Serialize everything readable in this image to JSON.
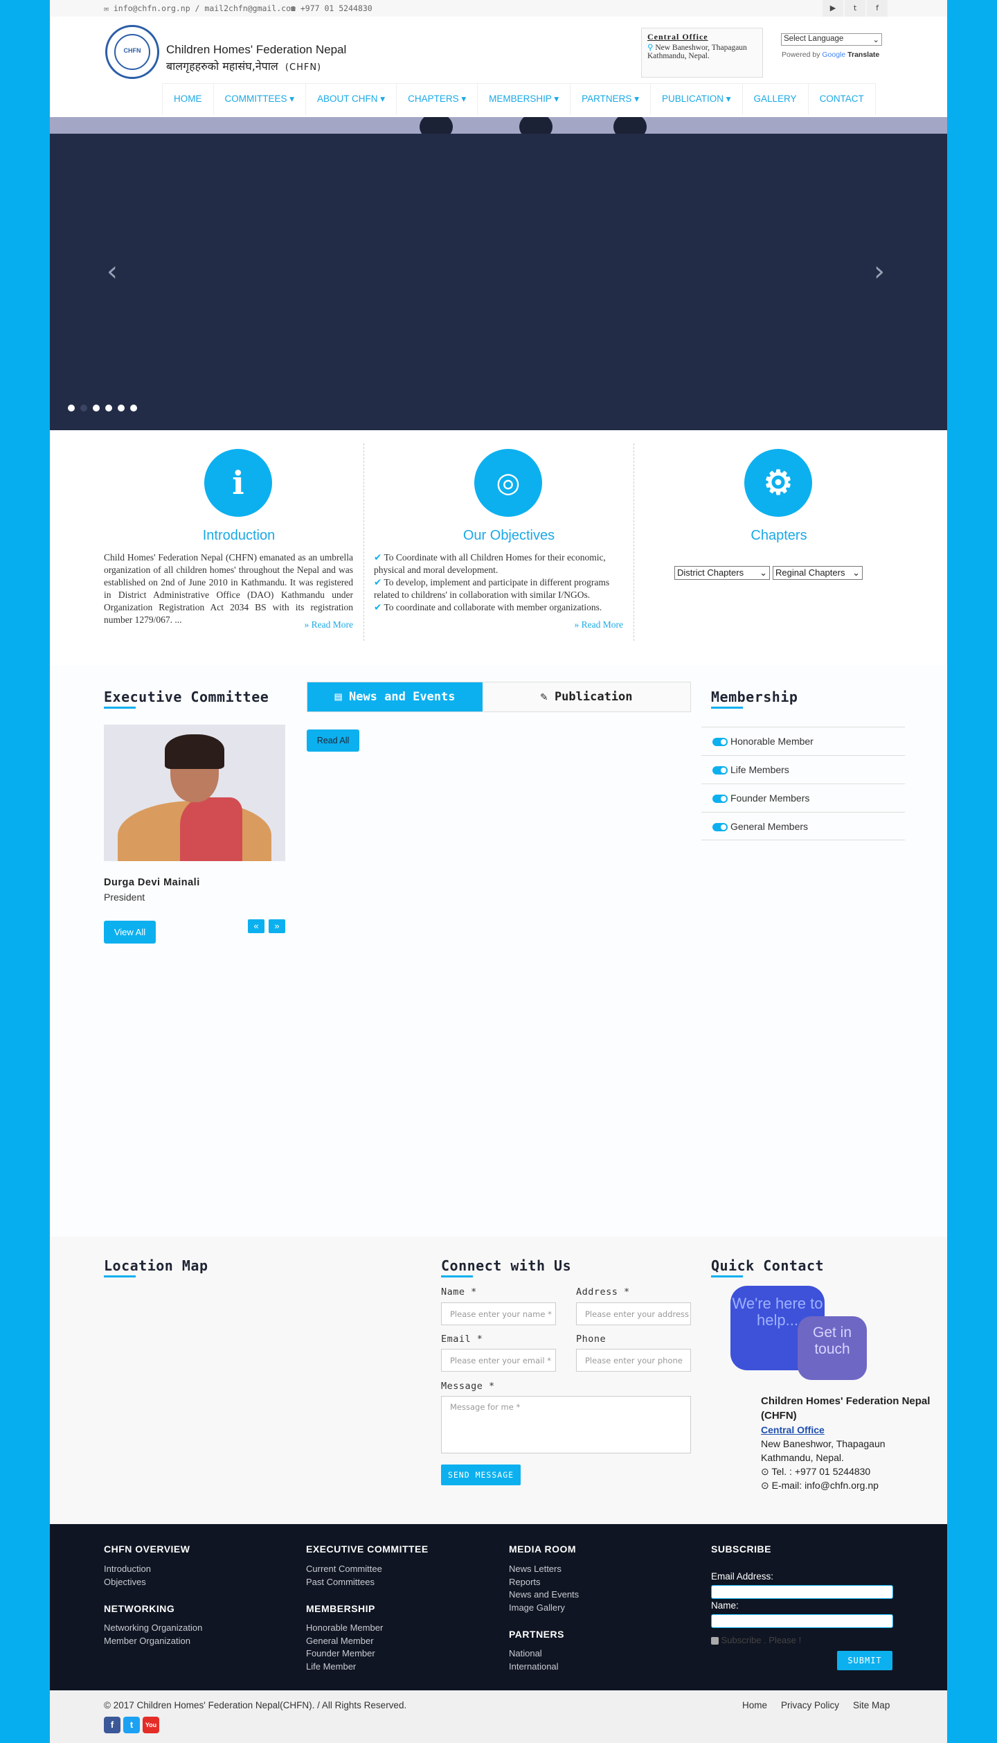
{
  "topbar": {
    "email": "info@chfn.org.np / mail2chfn@gmail.com",
    "phone": "+977 01 5244830",
    "social_icons": [
      "youtube-icon",
      "twitter-icon",
      "facebook-icon"
    ]
  },
  "logo": {
    "seal_text": "CHFN",
    "name_en": "Children Homes' Federation Nepal",
    "name_np": "बालगृहहरुको महासंघ,नेपाल",
    "abbr": "(CHFN)"
  },
  "office": {
    "title": "Central Office",
    "line1": "New Baneshwor, Thapagaun",
    "line2": "Kathmandu, Nepal."
  },
  "translate": {
    "select_label": "Select Language",
    "powered_by": "Powered by",
    "google": "Google",
    "translate": "Translate"
  },
  "nav": {
    "items": [
      {
        "label": "HOME"
      },
      {
        "label": "COMMITTEES ▾"
      },
      {
        "label": "ABOUT CHFN ▾"
      },
      {
        "label": "CHAPTERS ▾"
      },
      {
        "label": "MEMBERSHIP ▾"
      },
      {
        "label": "PARTNERS ▾"
      },
      {
        "label": "PUBLICATION ▾"
      },
      {
        "label": "GALLERY"
      },
      {
        "label": "CONTACT"
      }
    ]
  },
  "slider": {
    "prev": "‹",
    "next": "›",
    "active_index": 0,
    "slide_count": 6
  },
  "features": {
    "intro": {
      "title": "Introduction",
      "body": "Child Homes' Federation Nepal (CHFN) emanated as an umbrella organization of all children homes' throughout the Nepal and was established on 2nd of June 2010 in Kathmandu. It was registered in District Administrative Office (DAO) Kathmandu under Organization Registration Act 2034 BS with its registration number 1279/067. ...",
      "more": "» Read More"
    },
    "objectives": {
      "title": "Our Objectives",
      "items": [
        "To Coordinate with all Children Homes for their economic, physical and moral development.",
        "To develop, implement and participate in different programs related to childrens' in collaboration with similar I/NGOs.",
        "To coordinate and collaborate with member organizations."
      ],
      "more": "» Read More"
    },
    "chapters": {
      "title": "Chapters",
      "district": "District Chapters",
      "regional": "Reginal Chapters"
    }
  },
  "committee": {
    "title": "Executive Committee",
    "member_name": "Durga Devi Mainali",
    "member_role": "President",
    "view_all": "View All",
    "prev": "«",
    "next": "»"
  },
  "news": {
    "tab_news": "News and Events",
    "tab_pub": "Publication",
    "read_all": "Read All"
  },
  "membership": {
    "title": "Membership",
    "items": [
      "Honorable Member",
      "Life Members",
      "Founder Members",
      "General Members"
    ]
  },
  "location": {
    "title": "Location Map"
  },
  "connect": {
    "title": "Connect with Us",
    "name_label": "Name *",
    "name_ph": "Please enter your name *",
    "address_label": "Address *",
    "address_ph": "Please enter your address",
    "email_label": "Email *",
    "email_ph": "Please enter your email *",
    "phone_label": "Phone",
    "phone_ph": "Please enter your phone",
    "message_label": "Message *",
    "message_ph": "Message for me *",
    "send": "SEND MESSAGE"
  },
  "quick": {
    "title": "Quick Contact",
    "bubble1": "We're here to help...",
    "bubble2": "Get in touch",
    "org": "Children Homes' Federation Nepal (CHFN)",
    "office": "Central Office",
    "addr1": "New Baneshwor, Thapagaun",
    "addr2": "Kathmandu, Nepal.",
    "tel": "Tel. : +977 01 5244830",
    "email": "E-mail: info@chfn.org.np"
  },
  "footer": {
    "overview": {
      "title": "CHFN OVERVIEW",
      "links": [
        "Introduction",
        "Objectives"
      ]
    },
    "networking": {
      "title": "NETWORKING",
      "links": [
        "Networking Organization",
        "Member Organization"
      ]
    },
    "exec": {
      "title": "EXECUTIVE COMMITTEE",
      "links": [
        "Current Committee",
        "Past Committees"
      ]
    },
    "membership": {
      "title": "MEMBERSHIP",
      "links": [
        "Honorable Member",
        "General Member",
        "Founder Member",
        "Life Member"
      ]
    },
    "media": {
      "title": "MEDIA ROOM",
      "links": [
        "News Letters",
        "Reports",
        "News and Events",
        "Image Gallery"
      ]
    },
    "partners": {
      "title": "PARTNERS",
      "links": [
        "National",
        "International"
      ]
    },
    "subscribe": {
      "title": "SUBSCRIBE",
      "email_label": "Email Address:",
      "name_label": "Name:",
      "check_label": "Subscribe . Please !",
      "submit": "SUBMIT"
    }
  },
  "bottom": {
    "copyright": "© 2017 Children Homes' Federation Nepal(CHFN). / All Rights Reserved.",
    "links": [
      "Home",
      "Privacy Policy",
      "Site Map"
    ],
    "social": [
      "f",
      "t",
      "You"
    ]
  }
}
